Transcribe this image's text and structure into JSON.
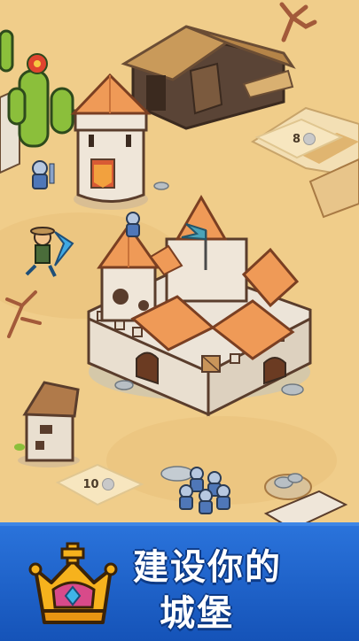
{
  "scene": {
    "plot_costs": [
      {
        "value": "8",
        "icon": "stone-coin-icon"
      },
      {
        "value": "10",
        "icon": "stone-coin-icon"
      }
    ]
  },
  "banner": {
    "line1": "建设你的",
    "line2": "城堡",
    "icon": "crown-icon",
    "color": "#1f63c8"
  }
}
